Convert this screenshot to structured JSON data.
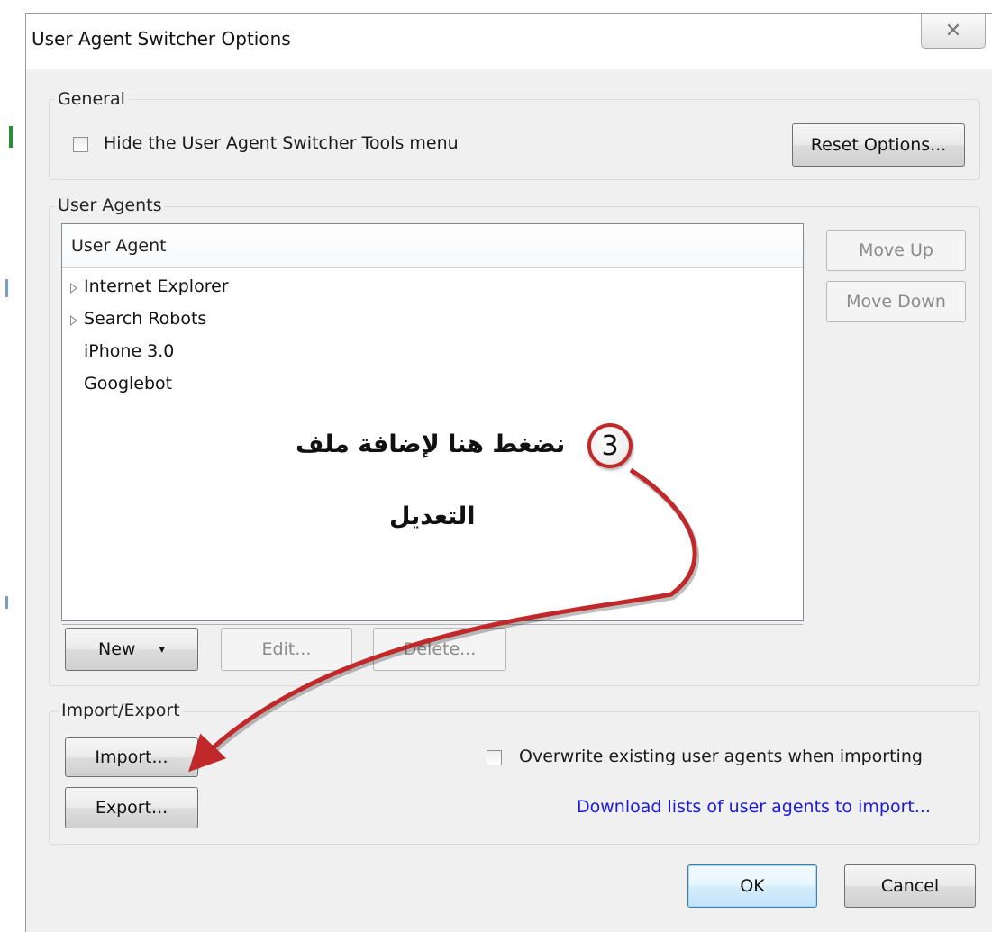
{
  "dialog": {
    "title": "User Agent Switcher Options",
    "close_glyph": "✕"
  },
  "general": {
    "label": "General",
    "hide_menu_label": "Hide the User Agent Switcher Tools menu",
    "hide_menu_checked": false,
    "reset_label": "Reset Options..."
  },
  "user_agents": {
    "label": "User Agents",
    "column_header": "User Agent",
    "items": [
      {
        "label": "Internet Explorer",
        "expandable": true
      },
      {
        "label": "Search Robots",
        "expandable": true
      },
      {
        "label": "iPhone 3.0",
        "expandable": false
      },
      {
        "label": "Googlebot",
        "expandable": false
      }
    ],
    "move_up_label": "Move Up",
    "move_down_label": "Move Down",
    "new_label": "New",
    "new_arrow": "▾",
    "edit_label": "Edit...",
    "delete_label": "Delete..."
  },
  "import_export": {
    "label": "Import/Export",
    "import_label": "Import...",
    "export_label": "Export...",
    "overwrite_label": "Overwrite existing user agents when importing",
    "overwrite_checked": false,
    "download_link": "Download lists of user agents to import..."
  },
  "footer": {
    "ok_label": "OK",
    "cancel_label": "Cancel"
  },
  "annotation": {
    "step_number": "3",
    "line1": "نضغط هنا لإضافة ملف",
    "line2": "التعديل",
    "color": "#c0282a"
  },
  "colors": {
    "link": "#1a1ae0",
    "default_button_border": "#3c7fb1"
  }
}
